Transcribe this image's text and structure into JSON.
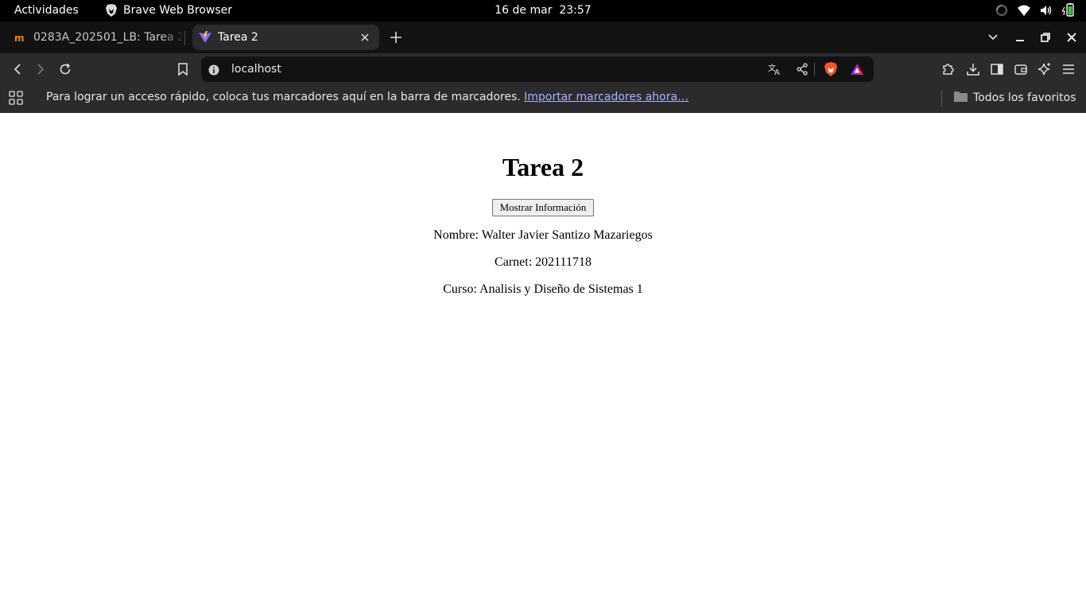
{
  "system_bar": {
    "activities": "Actividades",
    "app_name": "Brave Web Browser",
    "date": "16 de mar",
    "time": "23:57"
  },
  "tabs": [
    {
      "title": "0283A_202501_LB: Tarea 2",
      "active": false,
      "favicon": "moodle-icon"
    },
    {
      "title": "Tarea 2",
      "active": true,
      "favicon": "vite-icon"
    }
  ],
  "address_bar": {
    "url": "localhost"
  },
  "bookmarks_bar": {
    "message": "Para lograr un acceso rápido, coloca tus marcadores aquí en la barra de marcadores.",
    "import_link": "Importar marcadores ahora…",
    "all_bookmarks": "Todos los favoritos"
  },
  "page": {
    "title": "Tarea 2",
    "button_label": "Mostrar Información",
    "nombre": "Nombre: Walter Javier Santizo Mazariegos",
    "carnet": "Carnet: 202111718",
    "curso": "Curso: Analisis y Diseño de Sistemas 1"
  },
  "colors": {
    "system_bar_bg": "#000000",
    "tabstrip_bg": "#121212",
    "toolbar_bg": "#2b2b2e",
    "link": "#a9b4ff",
    "brave_orange": "#fb542b"
  }
}
